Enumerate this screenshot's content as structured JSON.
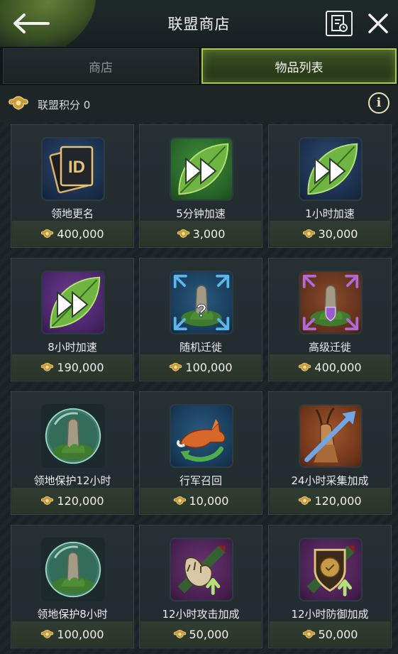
{
  "header": {
    "title": "联盟商店",
    "back_icon": "back-arrow-icon",
    "log_icon": "shop-log-icon",
    "close_icon": "close-icon"
  },
  "tabs": [
    {
      "label": "商店",
      "active": false
    },
    {
      "label": "物品列表",
      "active": true
    }
  ],
  "points": {
    "label": "联盟积分 0",
    "icon": "alliance-points-icon",
    "info_icon": "info-icon",
    "info_glyph": "i"
  },
  "items": [
    {
      "name": "领地更名",
      "price": "400,000",
      "icon": "id-card-icon",
      "id_text": "ID"
    },
    {
      "name": "5分钟加速",
      "price": "3,000",
      "icon": "speedup-leaf-icon"
    },
    {
      "name": "1小时加速",
      "price": "30,000",
      "icon": "speedup-leaf-icon"
    },
    {
      "name": "8小时加速",
      "price": "190,000",
      "icon": "speedup-leaf-icon"
    },
    {
      "name": "随机迁徙",
      "price": "100,000",
      "icon": "random-migrate-icon",
      "mark": "?"
    },
    {
      "name": "高级迁徙",
      "price": "400,000",
      "icon": "advanced-migrate-icon"
    },
    {
      "name": "领地保护12小时",
      "price": "120,000",
      "icon": "protection-orb-icon"
    },
    {
      "name": "行军召回",
      "price": "10,000",
      "icon": "march-recall-icon"
    },
    {
      "name": "24小时采集加成",
      "price": "120,000",
      "icon": "gather-boost-icon"
    },
    {
      "name": "领地保护8小时",
      "price": "100,000",
      "icon": "protection-orb-icon"
    },
    {
      "name": "12小时攻击加成",
      "price": "50,000",
      "icon": "attack-boost-icon"
    },
    {
      "name": "12小时防御加成",
      "price": "50,000",
      "icon": "defense-boost-icon"
    }
  ],
  "colors": {
    "accent_green": "#a9c94c",
    "gold": "#d9b45a",
    "background": "#1a2225"
  }
}
